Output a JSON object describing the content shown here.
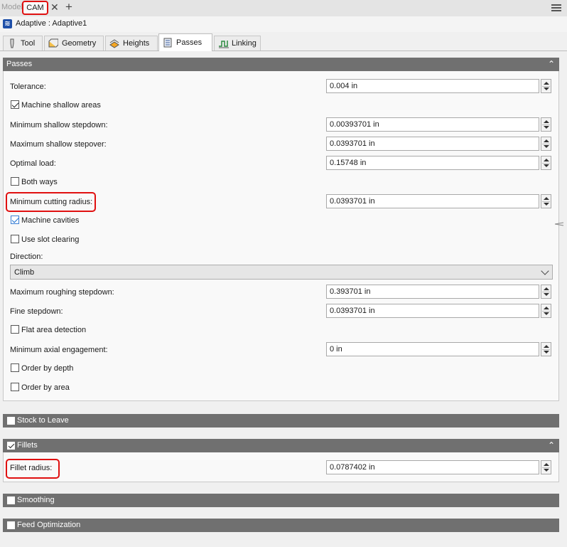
{
  "doc_tabs": {
    "model_label": "Model",
    "cam_label": "CAM",
    "close_glyph": "✕",
    "add_glyph": "+"
  },
  "operation": {
    "icon": "adaptive-operation-icon",
    "title": "Adaptive : Adaptive1"
  },
  "tabs": [
    {
      "label": "Tool",
      "icon": "tool-icon"
    },
    {
      "label": "Geometry",
      "icon": "geometry-icon"
    },
    {
      "label": "Heights",
      "icon": "heights-icon"
    },
    {
      "label": "Passes",
      "icon": "passes-icon",
      "active": true
    },
    {
      "label": "Linking",
      "icon": "linking-icon"
    }
  ],
  "passes": {
    "header": "Passes",
    "tolerance_label": "Tolerance:",
    "tolerance_value": "0.004 in",
    "shallow_label": "Machine shallow areas",
    "shallow_checked": true,
    "min_shallow_stepdown_label": "Minimum shallow stepdown:",
    "min_shallow_stepdown_value": "0.00393701 in",
    "max_shallow_stepover_label": "Maximum shallow stepover:",
    "max_shallow_stepover_value": "0.0393701 in",
    "optimal_load_label": "Optimal load:",
    "optimal_load_value": "0.15748 in",
    "both_ways_label": "Both ways",
    "both_ways_checked": false,
    "min_cutting_radius_label": "Minimum cutting radius:",
    "min_cutting_radius_value": "0.0393701 in",
    "machine_cavities_label": "Machine cavities",
    "machine_cavities_checked": true,
    "slot_clearing_label": "Use slot clearing",
    "slot_clearing_checked": false,
    "direction_label": "Direction:",
    "direction_value": "Climb",
    "max_roughing_stepdown_label": "Maximum roughing stepdown:",
    "max_roughing_stepdown_value": "0.393701 in",
    "fine_stepdown_label": "Fine stepdown:",
    "fine_stepdown_value": "0.0393701 in",
    "flat_area_label": "Flat area detection",
    "flat_area_checked": false,
    "min_axial_label": "Minimum axial engagement:",
    "min_axial_value": "0 in",
    "order_depth_label": "Order by depth",
    "order_depth_checked": false,
    "order_area_label": "Order by area",
    "order_area_checked": false
  },
  "stock_to_leave": {
    "label": "Stock to Leave",
    "checked": false
  },
  "fillets": {
    "label": "Fillets",
    "checked": true,
    "radius_label": "Fillet radius:",
    "radius_value": "0.0787402 in"
  },
  "smoothing": {
    "label": "Smoothing",
    "checked": false
  },
  "feed_optimization": {
    "label": "Feed Optimization",
    "checked": false
  },
  "colors": {
    "highlight": "#e01010",
    "section_bar": "#707070",
    "accent": "#1e4fa8"
  }
}
